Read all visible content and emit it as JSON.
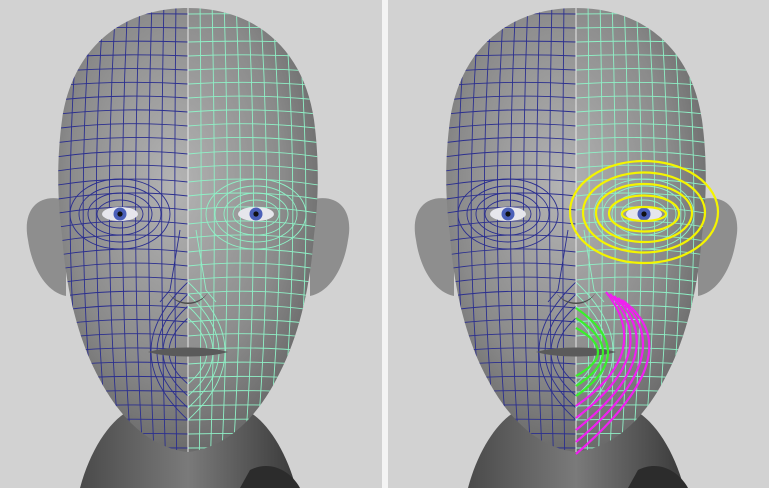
{
  "colors": {
    "background": "#d2d2d2",
    "divider": "#f4f4f4",
    "skin_light": "#b4b4b4",
    "skin_mid": "#8a8a8a",
    "skin_dark": "#5a5a5a",
    "wire_original": "#2b2f8f",
    "wire_retopo": "#8ff0c6",
    "edge_loop_eye": "#f4f400",
    "edge_loop_mouth_inner": "#39f02a",
    "edge_loop_mouth_outer": "#f020f0",
    "iris": "#4a5fb8"
  },
  "viewports": [
    {
      "name": "left",
      "edge_loops": false
    },
    {
      "name": "right",
      "edge_loops": true
    }
  ]
}
